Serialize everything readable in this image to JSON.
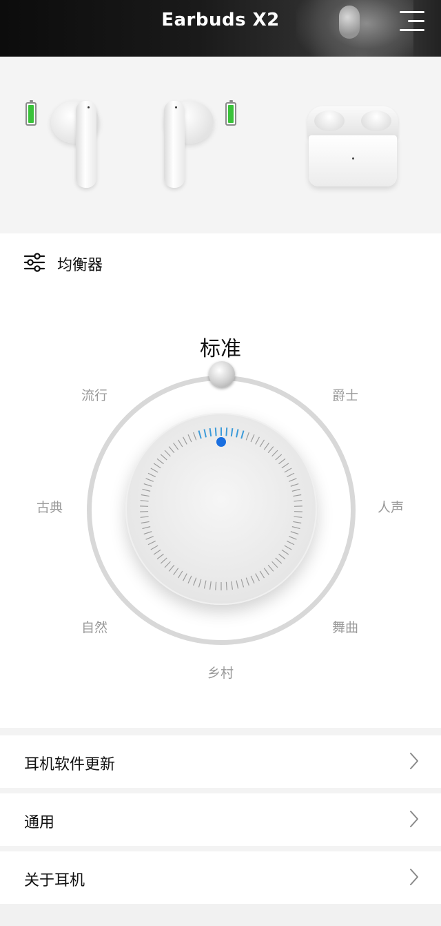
{
  "header": {
    "title": "Earbuds X2",
    "menu_icon": "hamburger-menu-icon"
  },
  "devices": {
    "left_battery_level": 1.0,
    "right_battery_level": 1.0,
    "battery_color": "#3ac23a"
  },
  "equalizer": {
    "label": "均衡器",
    "icon": "sliders-icon",
    "current_preset": "标准",
    "presets": {
      "pop": "流行",
      "jazz": "爵士",
      "classical": "古典",
      "vocal": "人声",
      "natural": "自然",
      "dance": "舞曲",
      "country": "乡村"
    },
    "accent_color": "#1a6fe0",
    "tick_highlight_color": "#3a9ad9"
  },
  "settings": {
    "items": [
      {
        "label": "耳机软件更新",
        "icon": "chevron-right-icon"
      },
      {
        "label": "通用",
        "icon": "chevron-right-icon"
      },
      {
        "label": "关于耳机",
        "icon": "chevron-right-icon"
      }
    ]
  }
}
